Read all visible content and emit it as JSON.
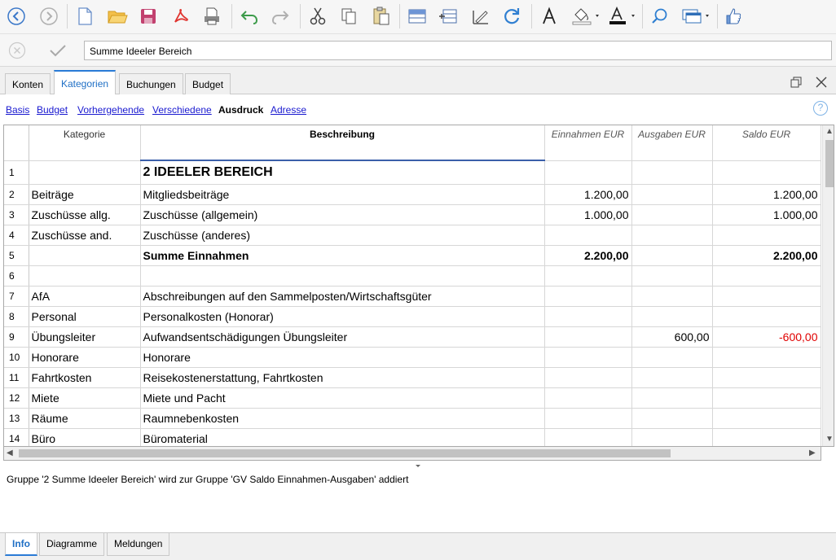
{
  "toolbar": {
    "buttons": [
      "back-icon",
      "forward-icon",
      "new-file-icon",
      "open-folder-icon",
      "save-icon",
      "pdf-icon",
      "print-preview-icon",
      "undo-icon",
      "redo-icon",
      "cut-icon",
      "copy-icon",
      "paste-icon",
      "insert-row-icon",
      "add-rows-icon",
      "edit-icon",
      "recalculate-icon",
      "font-icon",
      "fill-color-icon",
      "text-color-icon",
      "search-icon",
      "window-icon",
      "thumbs-up-icon"
    ]
  },
  "formula_bar": {
    "value": "Summe Ideeler Bereich"
  },
  "tabs": [
    {
      "label": "Konten"
    },
    {
      "label": "Kategorien"
    },
    {
      "label": "Buchungen"
    },
    {
      "label": "Budget"
    }
  ],
  "views": [
    {
      "label": "Basis"
    },
    {
      "label": "Budget"
    },
    {
      "label": "Vorhergehende"
    },
    {
      "label": "Verschiedene"
    },
    {
      "label": "Ausdruck"
    },
    {
      "label": "Adresse"
    }
  ],
  "help": "?",
  "table": {
    "headers": {
      "kategorie": "Kategorie",
      "beschreibung": "Beschreibung",
      "einnahmen": "Einnahmen EUR",
      "ausgaben": "Ausgaben EUR",
      "saldo": "Saldo EUR"
    },
    "rows": [
      {
        "n": "1",
        "kat": "",
        "desc": "2 IDEELER BEREICH",
        "ein": "",
        "aus": "",
        "saldo": ""
      },
      {
        "n": "2",
        "kat": "Beiträge",
        "desc": "Mitgliedsbeiträge",
        "ein": "1.200,00",
        "aus": "",
        "saldo": "1.200,00"
      },
      {
        "n": "3",
        "kat": "Zuschüsse allg.",
        "desc": "Zuschüsse (allgemein)",
        "ein": "1.000,00",
        "aus": "",
        "saldo": "1.000,00"
      },
      {
        "n": "4",
        "kat": "Zuschüsse and.",
        "desc": "Zuschüsse (anderes)",
        "ein": "",
        "aus": "",
        "saldo": ""
      },
      {
        "n": "5",
        "kat": "",
        "desc": "Summe Einnahmen",
        "ein": "2.200,00",
        "aus": "",
        "saldo": "2.200,00"
      },
      {
        "n": "6",
        "kat": "",
        "desc": "",
        "ein": "",
        "aus": "",
        "saldo": ""
      },
      {
        "n": "7",
        "kat": "AfA",
        "desc": "Abschreibungen auf den Sammelposten/Wirtschaftsgüter",
        "ein": "",
        "aus": "",
        "saldo": ""
      },
      {
        "n": "8",
        "kat": "Personal",
        "desc": "Personalkosten (Honorar)",
        "ein": "",
        "aus": "",
        "saldo": ""
      },
      {
        "n": "9",
        "kat": "Übungsleiter",
        "desc": "Aufwandsentschädigungen Übungsleiter",
        "ein": "",
        "aus": "600,00",
        "saldo": "-600,00"
      },
      {
        "n": "10",
        "kat": "Honorare",
        "desc": "Honorare",
        "ein": "",
        "aus": "",
        "saldo": ""
      },
      {
        "n": "11",
        "kat": "Fahrtkosten",
        "desc": "Reisekostenerstattung, Fahrtkosten",
        "ein": "",
        "aus": "",
        "saldo": ""
      },
      {
        "n": "12",
        "kat": "Miete",
        "desc": "Miete und Pacht",
        "ein": "",
        "aus": "",
        "saldo": ""
      },
      {
        "n": "13",
        "kat": "Räume",
        "desc": "Raumnebenkosten",
        "ein": "",
        "aus": "",
        "saldo": ""
      },
      {
        "n": "14",
        "kat": "Büro",
        "desc": "Büromaterial",
        "ein": "",
        "aus": "",
        "saldo": ""
      }
    ]
  },
  "info": {
    "message": "Gruppe '2 Summe Ideeler Bereich' wird zur Gruppe 'GV Saldo Einnahmen-Ausgaben' addiert"
  },
  "bottom_tabs": [
    {
      "label": "Info"
    },
    {
      "label": "Diagramme"
    },
    {
      "label": "Meldungen"
    }
  ],
  "colors": {
    "accent": "#2a7bd6",
    "negative": "#e00000",
    "link": "#1a1ad0"
  }
}
